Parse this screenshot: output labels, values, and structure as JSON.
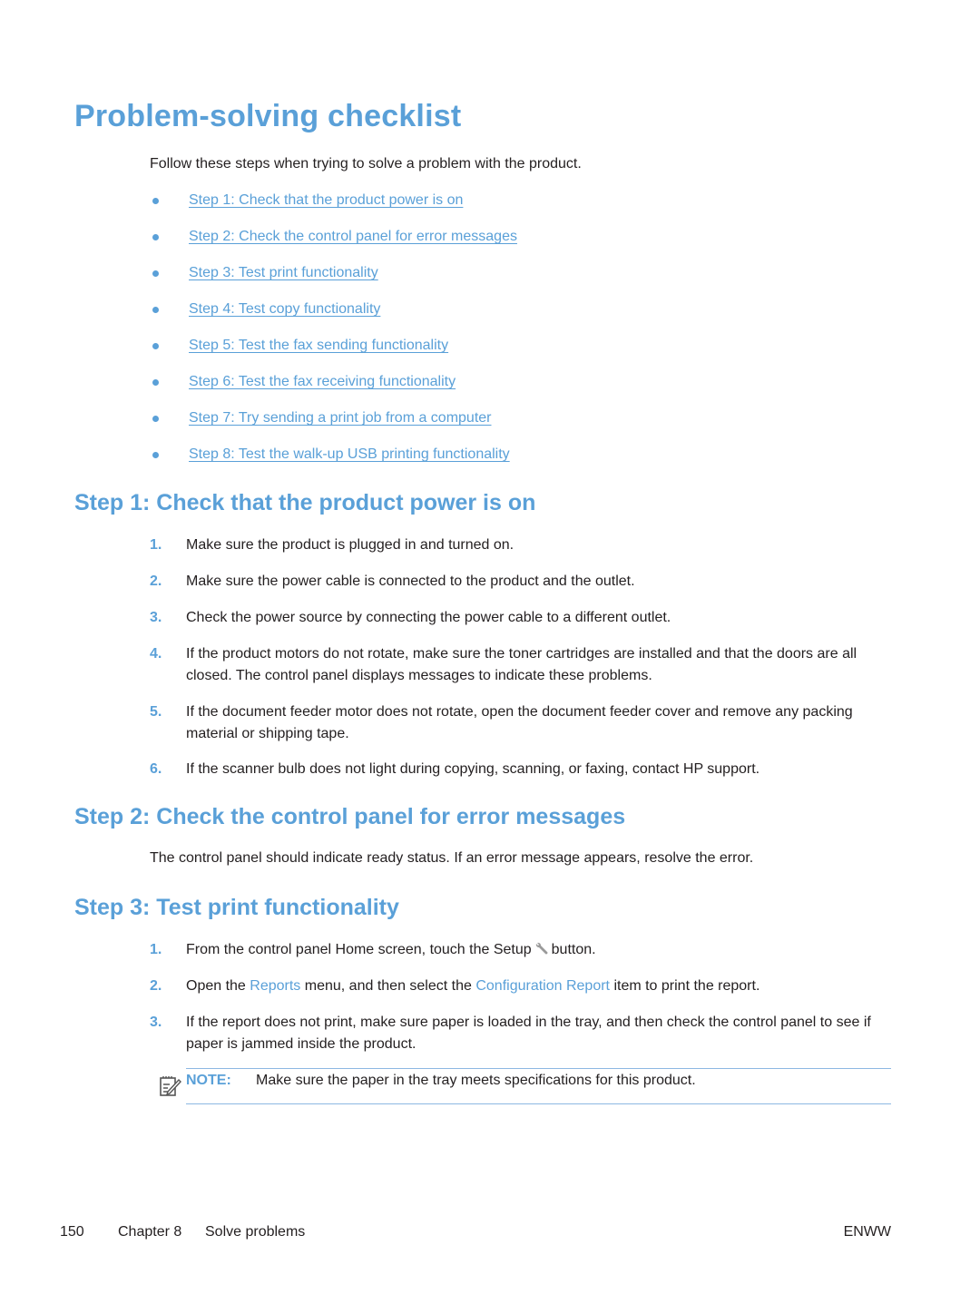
{
  "page_title": "Problem-solving checklist",
  "intro": "Follow these steps when trying to solve a problem with the product.",
  "toc": [
    "Step 1: Check that the product power is on",
    "Step 2: Check the control panel for error messages",
    "Step 3: Test print functionality",
    "Step 4: Test copy functionality",
    "Step 5: Test the fax sending functionality",
    "Step 6: Test the fax receiving functionality",
    "Step 7: Try sending a print job from a computer",
    "Step 8: Test the walk-up USB printing functionality"
  ],
  "step1": {
    "heading": "Step 1: Check that the product power is on",
    "items": [
      {
        "num": "1.",
        "text": "Make sure the product is plugged in and turned on."
      },
      {
        "num": "2.",
        "text": "Make sure the power cable is connected to the product and the outlet."
      },
      {
        "num": "3.",
        "text": "Check the power source by connecting the power cable to a different outlet."
      },
      {
        "num": "4.",
        "text": "If the product motors do not rotate, make sure the toner cartridges are installed and that the doors are all closed. The control panel displays messages to indicate these problems."
      },
      {
        "num": "5.",
        "text": "If the document feeder motor does not rotate, open the document feeder cover and remove any packing material or shipping tape."
      },
      {
        "num": "6.",
        "text": "If the scanner bulb does not light during copying, scanning, or faxing, contact HP support."
      }
    ]
  },
  "step2": {
    "heading": "Step 2: Check the control panel for error messages",
    "text": "The control panel should indicate ready status. If an error message appears, resolve the error."
  },
  "step3": {
    "heading": "Step 3: Test print functionality",
    "item1": {
      "num": "1.",
      "before": "From the control panel Home screen, touch the Setup",
      "after": "button."
    },
    "item2": {
      "num": "2.",
      "before": "Open the",
      "link1": "Reports",
      "middle": "menu, and then select the",
      "link2": "Configuration Report",
      "after": "item to print the report."
    },
    "item3": {
      "num": "3.",
      "text": "If the report does not print, make sure paper is loaded in the tray, and then check the control panel to see if paper is jammed inside the product."
    },
    "note_label": "NOTE:",
    "note_text": "Make sure the paper in the tray meets specifications for this product."
  },
  "footer": {
    "page_number": "150",
    "chapter": "Chapter 8",
    "section": "Solve problems",
    "right": "ENWW"
  }
}
